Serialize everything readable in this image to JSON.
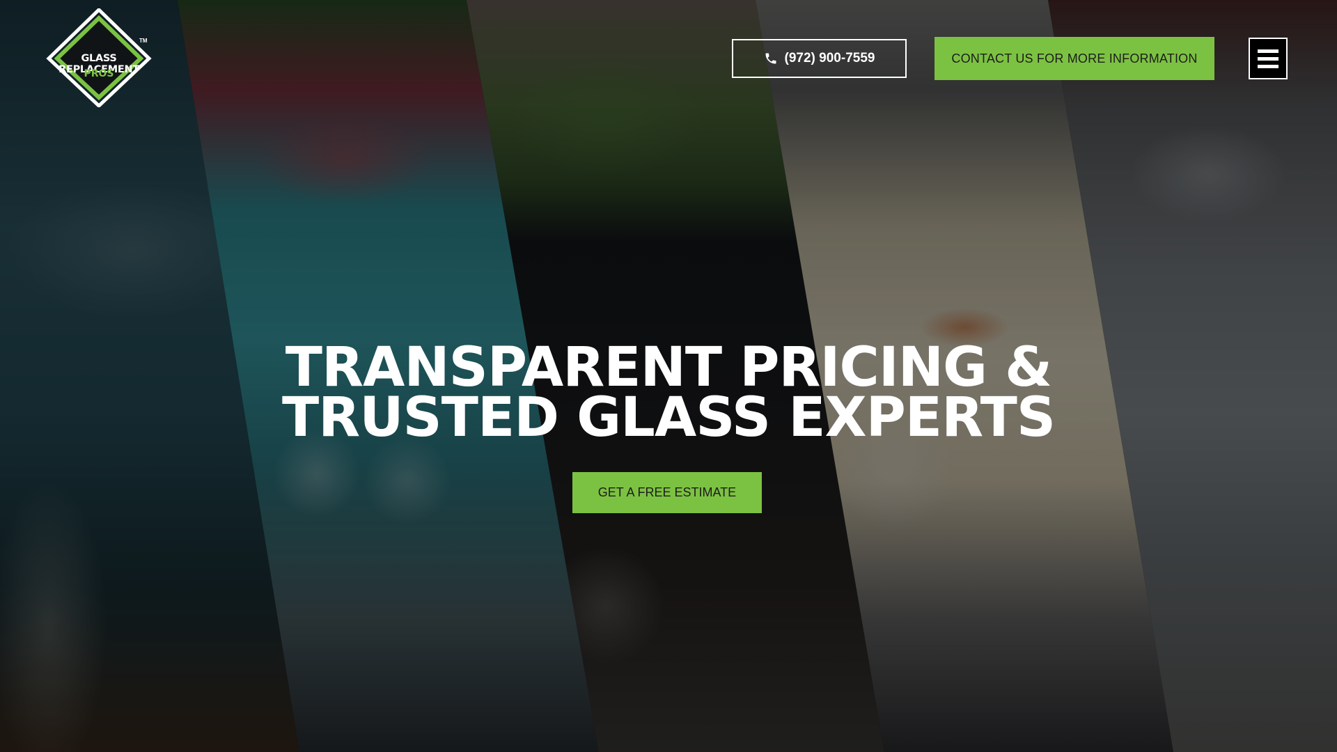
{
  "brand": {
    "logo_line1": "GLASS REPLACEMENT",
    "logo_line2": "PROS",
    "trademark": "TM",
    "accent_color": "#7cc242"
  },
  "header": {
    "phone_icon": "phone-icon",
    "phone_label": "(972) 900-7559",
    "contact_label": "CONTACT US FOR MORE INFORMATION",
    "menu_icon": "hamburger-menu-icon"
  },
  "hero": {
    "headline_line1": "TRANSPARENT PRICING &",
    "headline_line2": "TRUSTED GLASS EXPERTS",
    "cta_label": "GET A FREE ESTIMATE"
  }
}
